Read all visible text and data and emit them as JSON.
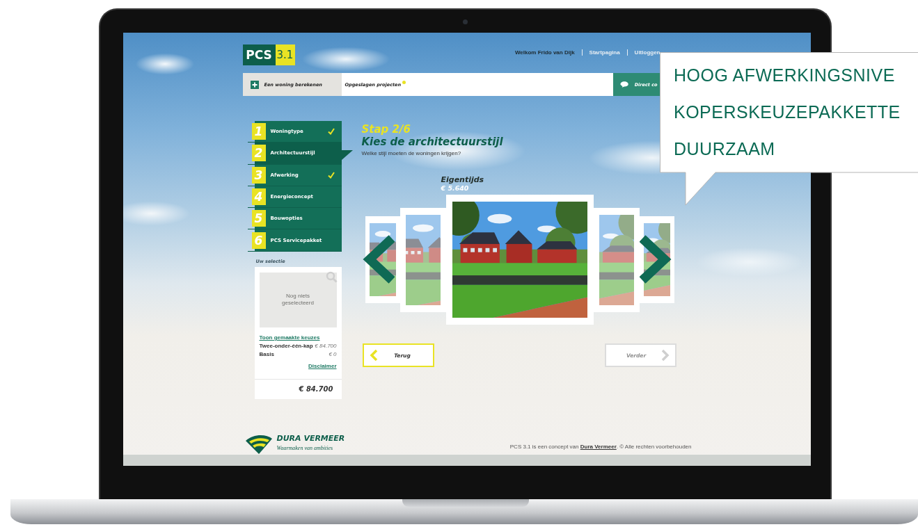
{
  "header": {
    "logo": {
      "name": "PCS",
      "version": "3.1"
    },
    "welcome": "Welkom Frido van Dijk",
    "links": [
      {
        "label": "Startpagina"
      },
      {
        "label": "Uitloggen"
      }
    ]
  },
  "toolbar": {
    "calculate": "Een woning berekenen",
    "saved_projects": "Opgeslagen projecten",
    "saved_badge": true,
    "direct_contact": "Direct co"
  },
  "steps": [
    {
      "number": "1",
      "label": "Woningtype",
      "done": true,
      "selected": false
    },
    {
      "number": "2",
      "label": "Architectuurstijl",
      "done": false,
      "selected": true
    },
    {
      "number": "3",
      "label": "Afwerking",
      "done": true,
      "selected": false
    },
    {
      "number": "4",
      "label": "Energieconcept",
      "done": false,
      "selected": false
    },
    {
      "number": "5",
      "label": "Bouwopties",
      "done": false,
      "selected": false
    },
    {
      "number": "6",
      "label": "PCS Servicepakket",
      "done": false,
      "selected": false
    }
  ],
  "heading": {
    "step": "Stap 2/6",
    "title": "Kies de architectuurstijl",
    "subtitle": "Welke stijl moeten de woningen krijgen?"
  },
  "selection": {
    "label": "Uw selectie",
    "image_placeholder": "Nog niets geselecteerd",
    "show_choices": "Toon gemaakte keuzes",
    "items": [
      {
        "name": "Twee-onder-één-kap",
        "price": "€ 84.700"
      },
      {
        "name": "Basis",
        "price": "€ 0"
      }
    ],
    "disclaimer": "Disclaimer",
    "total": "€ 84.700"
  },
  "carousel": {
    "title": "Eigentijds",
    "price": "€ 5.640",
    "slides": [
      {
        "selected": false
      },
      {
        "selected": false
      },
      {
        "selected": true
      },
      {
        "selected": false
      },
      {
        "selected": false
      }
    ]
  },
  "buttons": [
    {
      "kind": "back",
      "label": "Terug",
      "disabled": false
    },
    {
      "kind": "next",
      "label": "Verder",
      "disabled": true
    }
  ],
  "footer": {
    "brand": "DURA VERMEER",
    "tagline": "Waarmaken van ambities",
    "notice_before": "PCS 3.1 is een concept van",
    "notice_link": "Dura Vermeer",
    "notice_after": ". © Alle rechten voorbehouden"
  },
  "bubble": {
    "lines": [
      "HOOG AFWERKINGSNIVE",
      "KOPERSKEUZEPAKKETTE",
      "DUURZAAM"
    ]
  }
}
